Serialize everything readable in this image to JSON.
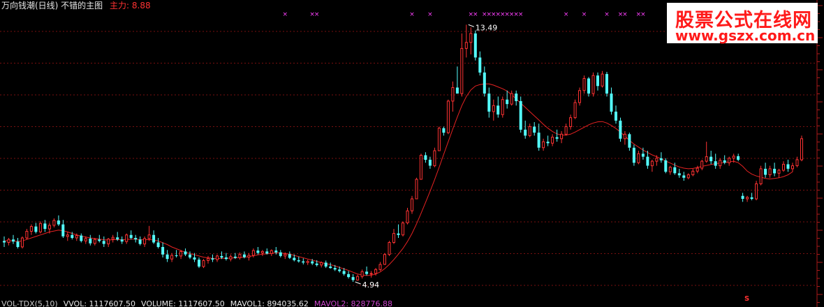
{
  "header": {
    "title": "万向钱潮(日线) 不错的主图",
    "main_label": "主力:",
    "main_value": "8.88"
  },
  "footer": {
    "items": [
      {
        "text": "VOL-TDX(5,10)",
        "color": "#c8c8c8"
      },
      {
        "text": "VVOL: 1117607.50",
        "color": "#e6e6e6"
      },
      {
        "text": "VOLUME: 1117607.50",
        "color": "#e6e6e6"
      },
      {
        "text": "MAVOL1: 894035.62",
        "color": "#e6e6e6"
      },
      {
        "text": "MAVOL2: 828776.88",
        "color": "#cc44cc"
      }
    ]
  },
  "watermark": {
    "line1": "股票公式在线网",
    "line2": "www.gszx.com.cn"
  },
  "chart_data": {
    "type": "candlestick",
    "annotations": {
      "high": {
        "label": "13.49",
        "value": 13.49
      },
      "low": {
        "label": "4.94",
        "value": 4.94
      }
    },
    "signal_marker": "×",
    "bottom_marker": "S",
    "colors": {
      "up": "#ff3232",
      "down": "#54ffff",
      "ma": "#e62222",
      "marker": "#ff40ff",
      "grid": "#7a1010",
      "axis": "#aa1a1a",
      "annotation": "#ffffff"
    },
    "ohlc": [
      [
        6.3,
        6.45,
        6.1,
        6.25
      ],
      [
        6.25,
        6.4,
        6.15,
        6.35
      ],
      [
        6.35,
        6.5,
        6.2,
        6.28
      ],
      [
        6.28,
        6.4,
        6.05,
        6.1
      ],
      [
        6.1,
        6.45,
        6.05,
        6.4
      ],
      [
        6.4,
        6.7,
        6.35,
        6.62
      ],
      [
        6.62,
        6.85,
        6.5,
        6.78
      ],
      [
        6.78,
        6.9,
        6.55,
        6.6
      ],
      [
        6.6,
        6.95,
        6.55,
        6.88
      ],
      [
        6.88,
        7.0,
        6.6,
        6.7
      ],
      [
        6.7,
        6.9,
        6.55,
        6.82
      ],
      [
        6.82,
        7.05,
        6.75,
        6.98
      ],
      [
        6.98,
        7.15,
        6.8,
        6.85
      ],
      [
        6.85,
        7.0,
        6.4,
        6.45
      ],
      [
        6.45,
        6.6,
        6.3,
        6.5
      ],
      [
        6.5,
        6.6,
        6.35,
        6.4
      ],
      [
        6.4,
        6.55,
        6.3,
        6.48
      ],
      [
        6.48,
        6.55,
        6.25,
        6.3
      ],
      [
        6.3,
        6.45,
        6.2,
        6.38
      ],
      [
        6.38,
        6.5,
        6.15,
        6.22
      ],
      [
        6.22,
        6.4,
        6.15,
        6.35
      ],
      [
        6.35,
        6.5,
        6.25,
        6.3
      ],
      [
        6.3,
        6.45,
        6.1,
        6.2
      ],
      [
        6.2,
        6.4,
        6.1,
        6.36
      ],
      [
        6.36,
        6.5,
        6.25,
        6.42
      ],
      [
        6.42,
        6.6,
        6.3,
        6.35
      ],
      [
        6.35,
        6.45,
        6.2,
        6.28
      ],
      [
        6.28,
        6.55,
        6.2,
        6.5
      ],
      [
        6.5,
        6.65,
        6.35,
        6.4
      ],
      [
        6.4,
        6.5,
        6.25,
        6.35
      ],
      [
        6.35,
        6.45,
        6.15,
        6.2
      ],
      [
        6.2,
        6.45,
        6.1,
        6.38
      ],
      [
        6.38,
        6.8,
        6.3,
        6.5
      ],
      [
        6.5,
        6.65,
        6.2,
        6.25
      ],
      [
        6.25,
        6.4,
        6.05,
        6.1
      ],
      [
        6.1,
        6.25,
        5.75,
        5.85
      ],
      [
        5.85,
        6.0,
        5.6,
        5.7
      ],
      [
        5.7,
        5.9,
        5.6,
        5.82
      ],
      [
        5.82,
        6.0,
        5.75,
        5.8
      ],
      [
        5.8,
        6.0,
        5.7,
        5.95
      ],
      [
        5.95,
        6.05,
        5.8,
        5.85
      ],
      [
        5.85,
        5.95,
        5.7,
        5.75
      ],
      [
        5.75,
        5.9,
        5.6,
        5.68
      ],
      [
        5.68,
        5.75,
        5.4,
        5.45
      ],
      [
        5.45,
        5.7,
        5.4,
        5.65
      ],
      [
        5.65,
        5.8,
        5.55,
        5.72
      ],
      [
        5.72,
        5.85,
        5.6,
        5.68
      ],
      [
        5.68,
        5.85,
        5.6,
        5.8
      ],
      [
        5.8,
        5.95,
        5.7,
        5.75
      ],
      [
        5.75,
        5.9,
        5.65,
        5.7
      ],
      [
        5.7,
        5.85,
        5.62,
        5.78
      ],
      [
        5.78,
        5.9,
        5.7,
        5.74
      ],
      [
        5.74,
        5.92,
        5.68,
        5.85
      ],
      [
        5.85,
        5.95,
        5.72,
        5.76
      ],
      [
        5.76,
        5.9,
        5.65,
        5.82
      ],
      [
        5.82,
        6.05,
        5.75,
        5.98
      ],
      [
        5.98,
        6.1,
        5.85,
        5.9
      ],
      [
        5.9,
        6.0,
        5.8,
        5.95
      ],
      [
        5.95,
        6.05,
        5.85,
        5.88
      ],
      [
        5.88,
        6.02,
        5.8,
        5.98
      ],
      [
        5.98,
        6.1,
        5.85,
        5.92
      ],
      [
        5.92,
        6.0,
        5.75,
        5.8
      ],
      [
        5.8,
        5.92,
        5.7,
        5.86
      ],
      [
        5.86,
        5.95,
        5.7,
        5.74
      ],
      [
        5.74,
        5.85,
        5.62,
        5.66
      ],
      [
        5.66,
        5.78,
        5.58,
        5.62
      ],
      [
        5.62,
        5.72,
        5.52,
        5.58
      ],
      [
        5.58,
        5.68,
        5.5,
        5.62
      ],
      [
        5.62,
        5.7,
        5.5,
        5.55
      ],
      [
        5.55,
        5.66,
        5.45,
        5.5
      ],
      [
        5.5,
        5.62,
        5.42,
        5.58
      ],
      [
        5.58,
        5.65,
        5.4,
        5.45
      ],
      [
        5.45,
        5.58,
        5.38,
        5.4
      ],
      [
        5.4,
        5.5,
        5.3,
        5.35
      ],
      [
        5.35,
        5.45,
        5.25,
        5.3
      ],
      [
        5.3,
        5.4,
        5.15,
        5.2
      ],
      [
        5.2,
        5.3,
        5.05,
        5.1
      ],
      [
        5.1,
        5.2,
        4.94,
        5.0
      ],
      [
        5.0,
        5.18,
        4.98,
        5.12
      ],
      [
        5.12,
        5.35,
        5.05,
        5.28
      ],
      [
        5.28,
        5.45,
        5.15,
        5.2
      ],
      [
        5.2,
        5.3,
        5.08,
        5.22
      ],
      [
        5.22,
        5.4,
        5.15,
        5.35
      ],
      [
        5.35,
        5.6,
        5.3,
        5.52
      ],
      [
        5.52,
        5.9,
        5.5,
        5.85
      ],
      [
        5.85,
        6.3,
        5.8,
        6.25
      ],
      [
        6.25,
        6.7,
        6.2,
        6.55
      ],
      [
        6.55,
        6.85,
        6.4,
        6.5
      ],
      [
        6.5,
        6.95,
        6.45,
        6.9
      ],
      [
        6.9,
        7.4,
        6.85,
        7.3
      ],
      [
        7.3,
        7.8,
        7.2,
        7.7
      ],
      [
        7.7,
        8.4,
        7.7,
        8.35
      ],
      [
        8.35,
        9.2,
        8.35,
        9.15
      ],
      [
        9.15,
        9.25,
        8.9,
        9.0
      ],
      [
        9.0,
        9.1,
        8.7,
        8.8
      ],
      [
        8.8,
        9.4,
        8.75,
        9.3
      ],
      [
        9.3,
        10.1,
        9.3,
        10.05
      ],
      [
        10.05,
        10.1,
        9.8,
        9.9
      ],
      [
        9.9,
        11.0,
        9.85,
        10.95
      ],
      [
        10.95,
        11.6,
        10.6,
        11.4
      ],
      [
        11.4,
        12.1,
        11.35,
        11.2
      ],
      [
        11.2,
        13.2,
        11.1,
        12.7
      ],
      [
        12.7,
        13.49,
        12.4,
        12.9
      ],
      [
        12.9,
        13.4,
        12.5,
        13.2
      ],
      [
        13.2,
        13.3,
        12.3,
        12.4
      ],
      [
        12.4,
        12.6,
        11.8,
        11.9
      ],
      [
        11.9,
        12.1,
        11.1,
        11.2
      ],
      [
        11.2,
        11.4,
        10.4,
        10.6
      ],
      [
        10.6,
        11.0,
        10.3,
        10.8
      ],
      [
        10.8,
        11.1,
        10.4,
        10.5
      ],
      [
        10.5,
        11.1,
        10.4,
        11.0
      ],
      [
        11.0,
        11.3,
        10.7,
        10.85
      ],
      [
        10.85,
        11.3,
        10.8,
        11.2
      ],
      [
        11.2,
        11.3,
        10.8,
        10.95
      ],
      [
        10.95,
        11.1,
        9.9,
        10.0
      ],
      [
        10.0,
        10.3,
        9.7,
        9.8
      ],
      [
        9.8,
        10.2,
        9.75,
        10.1
      ],
      [
        10.1,
        10.25,
        9.8,
        9.9
      ],
      [
        9.9,
        10.2,
        9.3,
        9.4
      ],
      [
        9.4,
        9.7,
        9.3,
        9.6
      ],
      [
        9.6,
        9.8,
        9.45,
        9.55
      ],
      [
        9.55,
        9.85,
        9.45,
        9.75
      ],
      [
        9.75,
        10.0,
        9.6,
        9.7
      ],
      [
        9.7,
        9.95,
        9.55,
        9.85
      ],
      [
        9.85,
        10.2,
        9.8,
        10.1
      ],
      [
        10.1,
        10.5,
        10.0,
        10.4
      ],
      [
        10.4,
        11.0,
        10.35,
        10.9
      ],
      [
        10.9,
        11.4,
        10.8,
        11.3
      ],
      [
        11.3,
        11.8,
        11.2,
        11.7
      ],
      [
        11.7,
        11.75,
        11.1,
        11.2
      ],
      [
        11.2,
        11.9,
        11.1,
        11.8
      ],
      [
        11.8,
        11.9,
        11.3,
        11.45
      ],
      [
        11.45,
        11.95,
        11.4,
        11.85
      ],
      [
        11.85,
        11.92,
        11.1,
        11.2
      ],
      [
        11.2,
        11.4,
        10.5,
        10.6
      ],
      [
        10.6,
        10.8,
        10.2,
        10.3
      ],
      [
        10.3,
        10.4,
        9.6,
        9.7
      ],
      [
        9.7,
        9.95,
        9.5,
        9.85
      ],
      [
        9.85,
        9.9,
        9.3,
        9.4
      ],
      [
        9.4,
        9.5,
        8.8,
        8.9
      ],
      [
        8.9,
        9.3,
        8.85,
        9.2
      ],
      [
        9.2,
        9.4,
        9.0,
        9.1
      ],
      [
        9.1,
        9.3,
        8.7,
        8.8
      ],
      [
        8.8,
        9.0,
        8.6,
        8.95
      ],
      [
        8.95,
        9.15,
        8.8,
        9.05
      ],
      [
        9.05,
        9.25,
        8.9,
        8.98
      ],
      [
        8.98,
        9.05,
        8.55,
        8.6
      ],
      [
        8.6,
        8.8,
        8.5,
        8.75
      ],
      [
        8.75,
        8.9,
        8.5,
        8.55
      ],
      [
        8.55,
        8.7,
        8.4,
        8.48
      ],
      [
        8.48,
        8.6,
        8.3,
        8.4
      ],
      [
        8.4,
        8.55,
        8.35,
        8.5
      ],
      [
        8.5,
        8.7,
        8.45,
        8.62
      ],
      [
        8.62,
        8.8,
        8.55,
        8.72
      ],
      [
        8.72,
        9.0,
        8.65,
        8.95
      ],
      [
        8.95,
        9.6,
        8.9,
        9.1
      ],
      [
        9.1,
        9.3,
        8.85,
        8.95
      ],
      [
        8.95,
        9.2,
        8.7,
        8.8
      ],
      [
        8.8,
        9.05,
        8.7,
        8.98
      ],
      [
        8.98,
        9.15,
        8.85,
        8.9
      ],
      [
        8.9,
        9.1,
        8.8,
        9.05
      ],
      [
        9.05,
        9.2,
        8.9,
        9.12
      ],
      [
        9.12,
        9.2,
        8.95,
        9.0
      ],
      [
        7.8,
        7.9,
        7.6,
        7.7
      ],
      [
        7.7,
        7.8,
        7.6,
        7.75
      ],
      [
        7.75,
        7.9,
        7.65,
        7.7
      ],
      [
        7.7,
        8.3,
        7.65,
        8.2
      ],
      [
        8.2,
        8.8,
        8.15,
        8.7
      ],
      [
        8.7,
        8.9,
        8.4,
        8.5
      ],
      [
        8.5,
        8.8,
        8.4,
        8.7
      ],
      [
        8.7,
        8.9,
        8.45,
        8.55
      ],
      [
        8.55,
        8.7,
        8.4,
        8.65
      ],
      [
        8.65,
        8.95,
        8.6,
        8.85
      ],
      [
        8.85,
        9.0,
        8.6,
        8.7
      ],
      [
        8.7,
        8.9,
        8.6,
        8.8
      ],
      [
        8.8,
        9.1,
        8.75,
        9.0
      ],
      [
        9.0,
        9.8,
        8.95,
        9.7
      ]
    ],
    "ma": [
      6.3,
      6.31,
      6.3,
      6.28,
      6.3,
      6.35,
      6.4,
      6.45,
      6.5,
      6.55,
      6.6,
      6.63,
      6.66,
      6.64,
      6.6,
      6.55,
      6.5,
      6.46,
      6.43,
      6.4,
      6.38,
      6.36,
      6.34,
      6.33,
      6.34,
      6.35,
      6.34,
      6.35,
      6.36,
      6.36,
      6.34,
      6.34,
      6.35,
      6.33,
      6.3,
      6.24,
      6.18,
      6.1,
      6.04,
      5.98,
      5.92,
      5.88,
      5.84,
      5.8,
      5.76,
      5.74,
      5.72,
      5.71,
      5.72,
      5.72,
      5.73,
      5.74,
      5.75,
      5.76,
      5.78,
      5.81,
      5.84,
      5.86,
      5.87,
      5.89,
      5.91,
      5.9,
      5.88,
      5.86,
      5.82,
      5.78,
      5.74,
      5.7,
      5.66,
      5.62,
      5.58,
      5.55,
      5.51,
      5.47,
      5.42,
      5.37,
      5.32,
      5.26,
      5.2,
      5.17,
      5.15,
      5.16,
      5.2,
      5.27,
      5.38,
      5.52,
      5.68,
      5.86,
      6.05,
      6.28,
      6.55,
      6.87,
      7.22,
      7.58,
      7.95,
      8.34,
      8.75,
      9.18,
      9.6,
      10.02,
      10.42,
      10.8,
      11.1,
      11.32,
      11.45,
      11.5,
      11.52,
      11.52,
      11.48,
      11.42,
      11.36,
      11.28,
      11.16,
      11.02,
      10.88,
      10.74,
      10.6,
      10.46,
      10.32,
      10.18,
      10.05,
      9.94,
      9.86,
      9.82,
      9.82,
      9.85,
      9.92,
      10.0,
      10.08,
      10.16,
      10.22,
      10.26,
      10.27,
      10.22,
      10.14,
      10.04,
      9.92,
      9.78,
      9.64,
      9.52,
      9.42,
      9.32,
      9.24,
      9.16,
      9.1,
      9.03,
      8.96,
      8.89,
      8.82,
      8.76,
      8.72,
      8.7,
      8.71,
      8.74,
      8.78,
      8.81,
      8.84,
      8.87,
      8.89,
      8.91,
      8.93,
      8.95,
      8.9,
      8.78,
      8.62,
      8.52,
      8.46,
      8.42,
      8.38,
      8.36,
      8.38,
      8.4,
      8.44,
      8.5,
      8.6
    ],
    "signals": [
      62,
      68,
      69,
      90,
      94,
      103,
      104,
      106,
      107,
      108,
      109,
      110,
      111,
      112,
      113,
      114,
      124,
      128,
      133,
      136,
      137,
      140,
      141,
      147,
      150,
      154,
      157
    ]
  }
}
